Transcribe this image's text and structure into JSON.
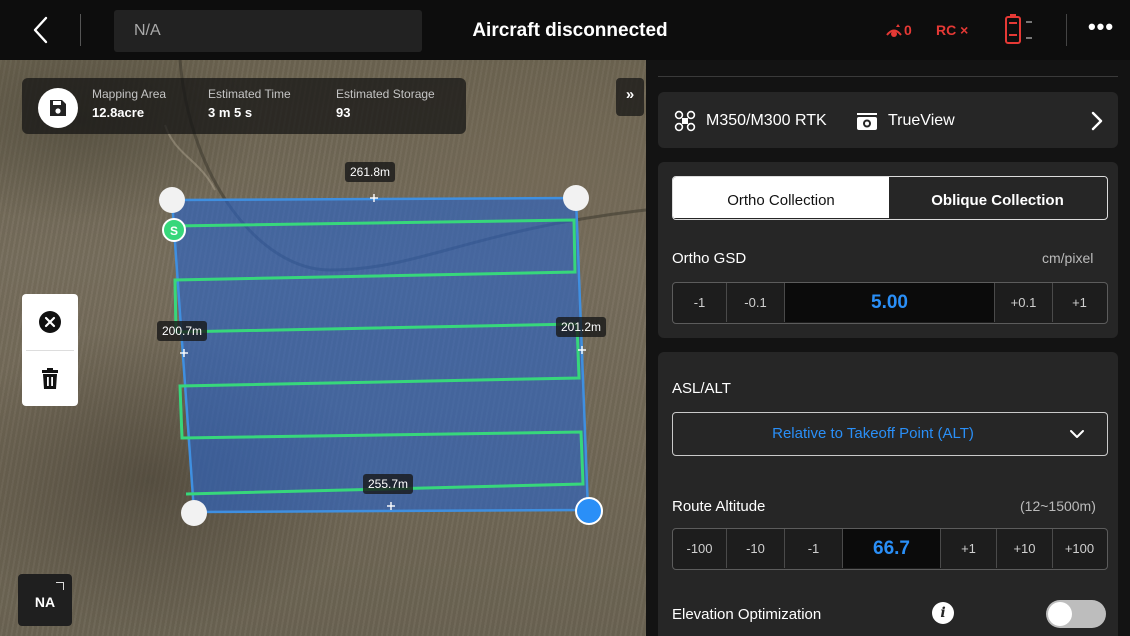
{
  "topbar": {
    "aircraft_name": "N/A",
    "status_title": "Aircraft disconnected",
    "signal_value": "0",
    "rc_status": "RC ×",
    "icons": [
      "back-arrow-icon",
      "signal-icon",
      "battery-icon",
      "more-icon"
    ]
  },
  "map": {
    "info": {
      "area_label": "Mapping Area",
      "area_value": "12.8acre",
      "time_label": "Estimated Time",
      "time_value": "3 m 5 s",
      "storage_label": "Estimated Storage",
      "storage_value": "93"
    },
    "collapse_label": "»",
    "start_marker_label": "S",
    "dimensions": {
      "top": "261.8m",
      "left": "200.7m",
      "right": "201.2m",
      "bottom": "255.7m"
    },
    "na_label": "NA",
    "colors": {
      "area_fill": "#2a64c8",
      "area_border": "#3f8fe0",
      "route_line": "#37d77b",
      "selected_vertex": "#2a8ff7"
    }
  },
  "panel": {
    "drone_model": "M350/M300 RTK",
    "camera_name": "TrueView",
    "tabs": {
      "ortho": "Ortho Collection",
      "oblique": "Oblique Collection",
      "selected": "ortho"
    },
    "gsd": {
      "label": "Ortho GSD",
      "unit": "cm/pixel",
      "minus1": "-1",
      "minus01": "-0.1",
      "value": "5.00",
      "plus01": "+0.1",
      "plus1": "+1"
    },
    "asl": {
      "label": "ASL/ALT",
      "dropdown_value": "Relative to Takeoff Point (ALT)"
    },
    "altitude": {
      "label": "Route Altitude",
      "range": "(12~1500m)",
      "minus100": "-100",
      "minus10": "-10",
      "minus1": "-1",
      "value": "66.7",
      "plus1": "+1",
      "plus10": "+10",
      "plus100": "+100"
    },
    "elevation": {
      "label": "Elevation Optimization",
      "toggle_on": false
    },
    "accent_color": "#2a8ff7"
  }
}
